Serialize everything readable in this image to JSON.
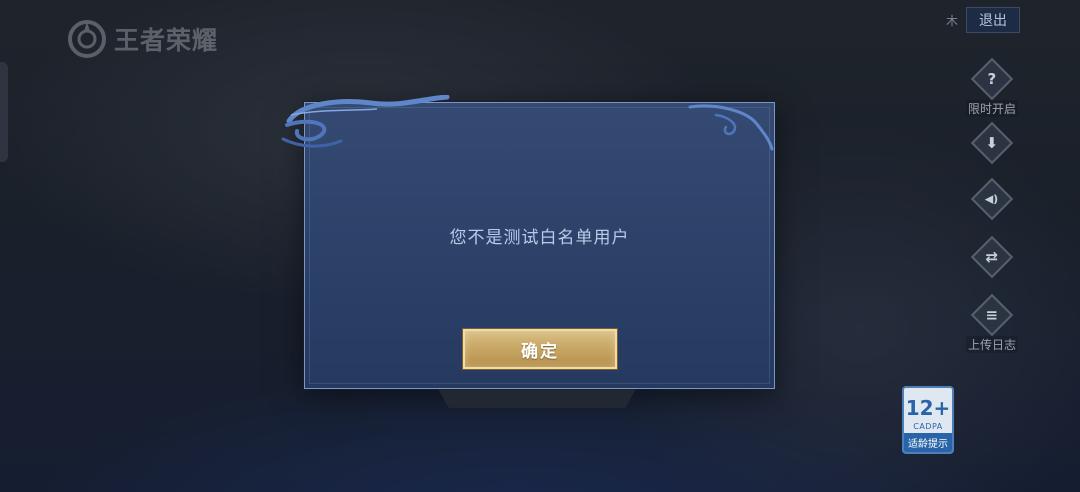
{
  "app": {
    "logo_text": "王者荣耀"
  },
  "top_bar": {
    "small_char": "木",
    "exit_label": "退出"
  },
  "side_buttons": [
    {
      "icon": "help-icon",
      "glyph": "?",
      "label": "限时开启"
    },
    {
      "icon": "download-icon",
      "glyph": "⬇",
      "label": ""
    },
    {
      "icon": "speaker-icon",
      "glyph": "◀)",
      "label": ""
    },
    {
      "icon": "switch-icon",
      "glyph": "⇄",
      "label": ""
    },
    {
      "icon": "notice-icon",
      "glyph": "≡",
      "label": "上传日志"
    }
  ],
  "age_rating": {
    "age": "12+",
    "org": "CADPA",
    "tip": "适龄提示"
  },
  "dialog": {
    "message": "您不是测试白名单用户",
    "confirm_label": "确定"
  },
  "colors": {
    "dialog_bg": "#2e4469",
    "button_gold": "#c9a866",
    "age_blue": "#2a64a8"
  }
}
